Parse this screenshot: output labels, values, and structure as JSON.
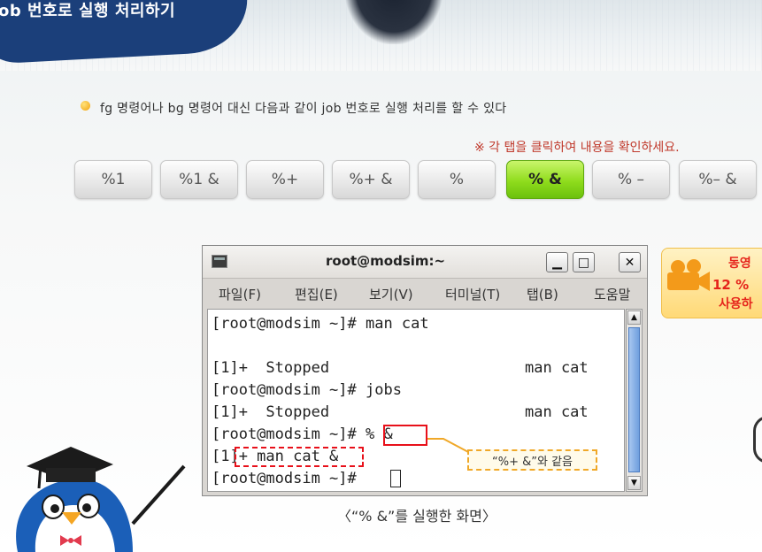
{
  "banner": {
    "title": "ob 번호로 실행 처리하기"
  },
  "content": {
    "bullet_text": "fg 명령어나 bg 명령어 대신 다음과 같이 job 번호로 실행 처리를 할 수 있다",
    "notice": "※ 각 탭을 클릭하여 내용을 확인하세요."
  },
  "tabs": [
    {
      "label": "%1",
      "active": false
    },
    {
      "label": "%1 &",
      "active": false
    },
    {
      "label": "%+",
      "active": false
    },
    {
      "label": "%+ &",
      "active": false
    },
    {
      "label": "%",
      "active": false
    },
    {
      "label": "% &",
      "active": true
    },
    {
      "label": "% –",
      "active": false
    },
    {
      "label": "%– &",
      "active": false
    }
  ],
  "terminal": {
    "title": "root@modsim:~",
    "buttons": {
      "minimize": "▁",
      "maximize": "□",
      "close": "✕"
    },
    "menu": [
      "파일(F)",
      "편집(E)",
      "보기(V)",
      "터미널(T)",
      "탭(B)",
      "도움말"
    ],
    "lines": [
      {
        "left": "[root@modsim ~]# man cat",
        "right": ""
      },
      {
        "left": "",
        "right": ""
      },
      {
        "left": "[1]+  Stopped",
        "right": "man cat"
      },
      {
        "left": "[root@modsim ~]# jobs",
        "right": ""
      },
      {
        "left": "[1]+  Stopped",
        "right": "man cat"
      },
      {
        "left": "[root@modsim ~]# % &",
        "right": ""
      },
      {
        "left": "[1]+ man cat &",
        "right": ""
      },
      {
        "left": "[root@modsim ~]# ",
        "right": ""
      }
    ],
    "scroll_up": "▲",
    "scroll_down": "▼"
  },
  "callout": {
    "text": "“%+ &”와 같음"
  },
  "caption": "〈“% &”를 실행한 화면〉",
  "video": {
    "line1": "동영",
    "line2": "12 %",
    "line3": "사용하"
  },
  "colors": {
    "accent_green": "#8fdc1c",
    "highlight_red": "#e8101a",
    "banner_blue": "#1b3f7a",
    "callout_orange": "#f0a828"
  }
}
